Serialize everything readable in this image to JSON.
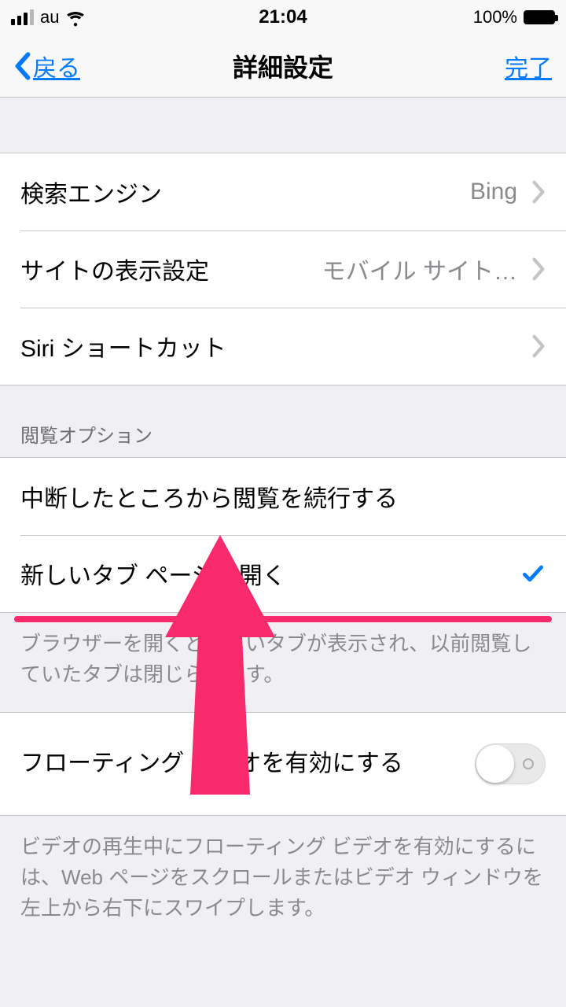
{
  "status": {
    "carrier": "au",
    "time": "21:04",
    "battery_pct": "100%"
  },
  "nav": {
    "back": "戻る",
    "title": "詳細設定",
    "done": "完了"
  },
  "section1": {
    "rows": [
      {
        "label": "検索エンジン",
        "value": "Bing"
      },
      {
        "label": "サイトの表示設定",
        "value": "モバイル サイト…"
      },
      {
        "label": "Siri ショートカット",
        "value": ""
      }
    ]
  },
  "section2": {
    "header": "閲覧オプション",
    "rows": [
      {
        "label": "中断したところから閲覧を続行する"
      },
      {
        "label": "新しいタブ ページを開く"
      }
    ],
    "footer": "ブラウザーを開くと新しいタブが表示され、以前閲覧していたタブは閉じられます。"
  },
  "section3": {
    "row": {
      "label": "フローティング ビデオを有効にする"
    },
    "footer": "ビデオの再生中にフローティング ビデオを有効にするには、Web ページをスクロールまたはビデオ ウィンドウを左上から右下にスワイプします。"
  },
  "colors": {
    "accent": "#007aff",
    "annotation": "#f92a6b"
  }
}
